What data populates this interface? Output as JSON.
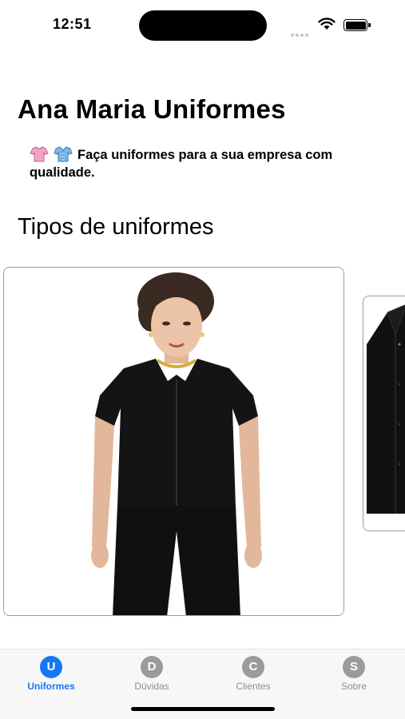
{
  "status_bar": {
    "time": "12:51"
  },
  "header": {
    "title": "Ana Maria Uniformes",
    "subtitle": "Faça uniformes para a sua empresa com qualidade.",
    "subtitle_icons": [
      "blouse-icon",
      "shirt-icon"
    ]
  },
  "section": {
    "title": "Tipos de uniformes"
  },
  "carousel": {
    "items": [
      {
        "image": "woman-black-blouse-uniform-photo"
      },
      {
        "image": "black-dress-shirt-uniform-photo"
      }
    ]
  },
  "tab_bar": {
    "tabs": [
      {
        "letter": "U",
        "label": "Uniformes",
        "active": true
      },
      {
        "letter": "D",
        "label": "Dúvidas",
        "active": false
      },
      {
        "letter": "C",
        "label": "Clientes",
        "active": false
      },
      {
        "letter": "S",
        "label": "Sobre",
        "active": false
      }
    ],
    "active_color": "#1677f2",
    "inactive_color": "#9b9b9b"
  }
}
